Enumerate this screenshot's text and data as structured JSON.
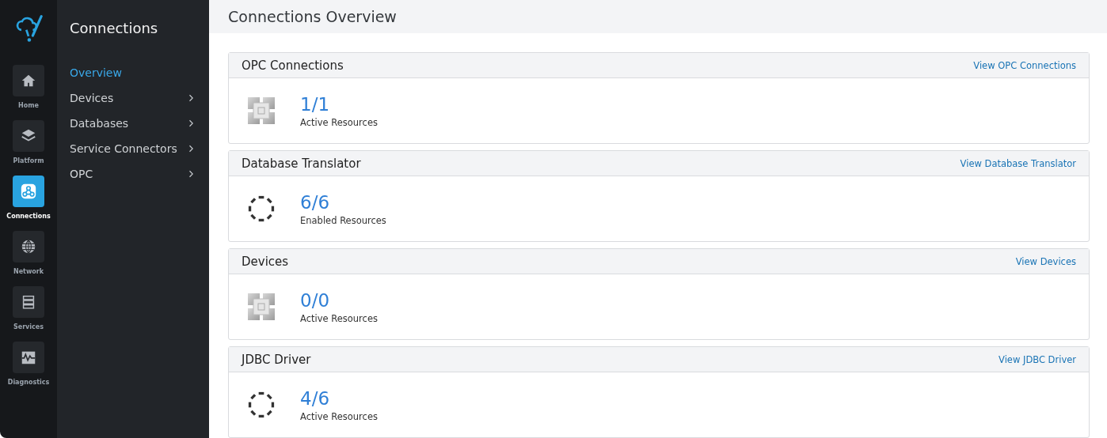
{
  "rail": [
    {
      "label": "Home",
      "kind": "home",
      "selected": false
    },
    {
      "label": "Platform",
      "kind": "layers",
      "selected": false
    },
    {
      "label": "Connections",
      "kind": "connections",
      "selected": true
    },
    {
      "label": "Network",
      "kind": "globe",
      "selected": false
    },
    {
      "label": "Services",
      "kind": "servers",
      "selected": false
    },
    {
      "label": "Diagnostics",
      "kind": "pulse",
      "selected": false
    }
  ],
  "sidebar": {
    "title": "Connections",
    "items": [
      {
        "label": "Overview",
        "selected": true,
        "has_submenu": false
      },
      {
        "label": "Devices",
        "selected": false,
        "has_submenu": true
      },
      {
        "label": "Databases",
        "selected": false,
        "has_submenu": true
      },
      {
        "label": "Service Connectors",
        "selected": false,
        "has_submenu": true
      },
      {
        "label": "OPC",
        "selected": false,
        "has_submenu": true
      }
    ]
  },
  "page": {
    "title": "Connections Overview"
  },
  "cards": [
    {
      "title": "OPC Connections",
      "link": "View OPC Connections",
      "kind": "chip",
      "count": "1/1",
      "caption": "Active Resources"
    },
    {
      "title": "Database Translator",
      "link": "View Database Translator",
      "kind": "ring",
      "count": "6/6",
      "caption": "Enabled Resources"
    },
    {
      "title": "Devices",
      "link": "View Devices",
      "kind": "chip",
      "count": "0/0",
      "caption": "Active Resources"
    },
    {
      "title": "JDBC Driver",
      "link": "View JDBC Driver",
      "kind": "ring",
      "count": "4/6",
      "caption": "Active Resources"
    }
  ]
}
